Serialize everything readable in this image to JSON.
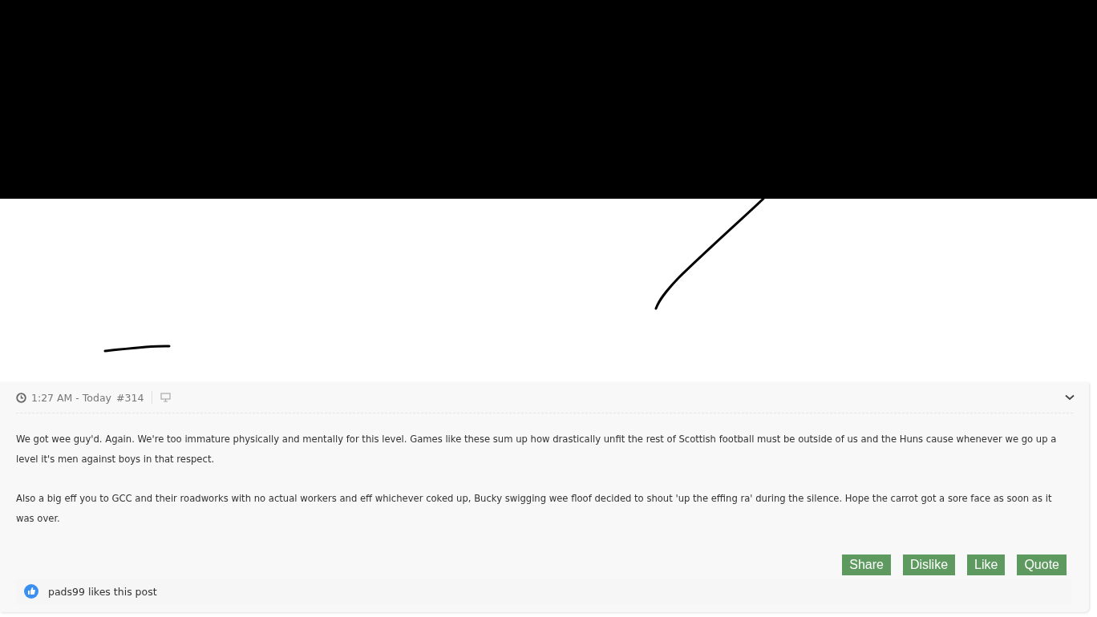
{
  "post": {
    "time": "1:27 AM - Today",
    "number": "#314",
    "paragraphs": [
      "We got wee guy'd. Again. We're too immature physically and mentally for this level. Games like these sum up how drastically unfit the rest of Scottish football must be outside of us and the Huns cause whenever we go up a level it's men against boys in that respect.",
      "Also a big eff you to GCC and their roadworks with no actual workers and eff whichever coked up, Bucky swigging wee floof decided to shout 'up the effing ra' during the silence. Hope the carrot got a sore face as soon as it was over."
    ],
    "actions": [
      {
        "label": "Share"
      },
      {
        "label": "Dislike"
      },
      {
        "label": "Like"
      },
      {
        "label": "Quote"
      }
    ],
    "likes": "pads99 likes this post"
  }
}
